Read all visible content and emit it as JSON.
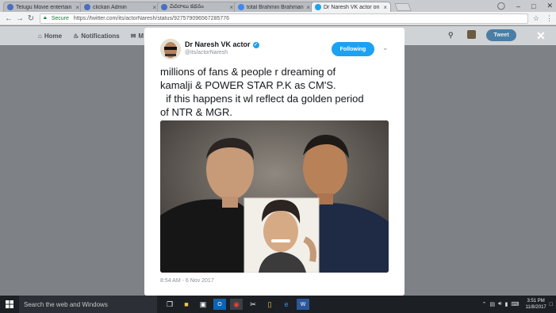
{
  "browser": {
    "tabs": [
      {
        "title": "Telugu Movie entertain",
        "favicon_color": "#4a6fbf",
        "active": false
      },
      {
        "title": "clickan Admin",
        "favicon_color": "#4a6fbf",
        "active": false
      },
      {
        "title": "వివరాలు కథనం",
        "favicon_color": "#4a6fbf",
        "active": false
      },
      {
        "title": "total Brahmin Brahmana",
        "favicon_color": "#4285f4",
        "active": false
      },
      {
        "title": "Dr Naresh VK actor on T",
        "favicon_color": "#1da1f2",
        "active": true
      }
    ],
    "secure_label": "Secure",
    "url": "https://twitter.com/its/actorNaresh/status/927579096567285776"
  },
  "twitter": {
    "nav_home": "Home",
    "nav_notifications": "Notifications",
    "nav_messages": "M",
    "tweet_button": "Tweet"
  },
  "tweet": {
    "display_name": "Dr Naresh VK actor",
    "handle": "@its/actorNaresh",
    "follow_label": "Following",
    "text": "millions of fans & people r dreaming of\nkamalji & POWER STAR P.K as CM'S.\n  if this happens it wl reflect da golden period\nof NTR & MGR.",
    "timestamp": "8:54 AM - 6 Nov 2017"
  },
  "taskbar": {
    "search_placeholder": "Search the web and Windows",
    "time": "3:51 PM",
    "date": "11/8/2017"
  },
  "colors": {
    "twitter_blue": "#1da1f2",
    "taskbar": "#1c1f24"
  }
}
